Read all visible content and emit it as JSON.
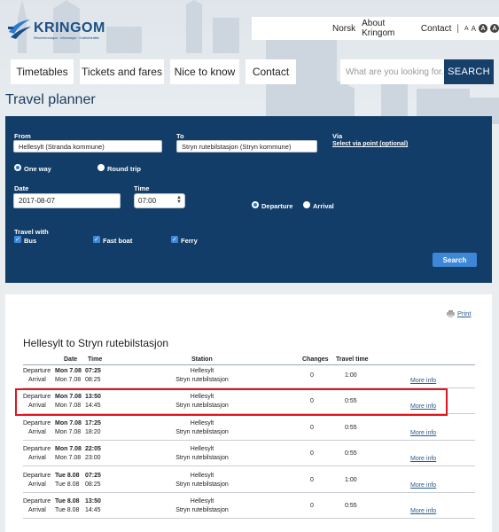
{
  "brand": {
    "name": "KRINGOM",
    "tagline": "Reiseinformasjon · Informasjon · Kollektivtrafikk"
  },
  "topbar": {
    "lang": "Norsk",
    "about": "About Kringom",
    "contact": "Contact",
    "sep": "|",
    "font_sizes": [
      "A",
      "A",
      "A",
      "A"
    ]
  },
  "nav": {
    "items": [
      "Timetables",
      "Tickets and fares",
      "Nice to know",
      "Contact"
    ]
  },
  "search": {
    "placeholder": "What are you looking for..?",
    "button": "SEARCH"
  },
  "planner": {
    "title": "Travel planner",
    "from_label": "From",
    "from_value": "Hellesylt (Stranda kommune)",
    "to_label": "To",
    "to_value": "Stryn rutebilstasjon (Stryn kommune)",
    "via_label": "Via",
    "via_link": "Select via point (optional)",
    "one_way": "One way",
    "round_trip": "Round trip",
    "date_label": "Date",
    "date_value": "2017-08-07",
    "time_label": "Time",
    "time_value": "07:00",
    "departure": "Departure",
    "arrival": "Arrival",
    "travel_with": "Travel with",
    "modes": [
      "Bus",
      "Fast boat",
      "Ferry"
    ],
    "search_button": "Search"
  },
  "results": {
    "print": "Print",
    "title": "Hellesylt to Stryn rutebilstasjon",
    "headers": {
      "date": "Date",
      "time": "Time",
      "station": "Station",
      "changes": "Changes",
      "travel_time": "Travel time"
    },
    "dep_label": "Departure",
    "arr_label": "Arrival",
    "more_info": "More info",
    "rows": [
      {
        "dep_date": "Mon 7.08",
        "dep_time": "07:25",
        "arr_date": "Mon 7.08",
        "arr_time": "08:25",
        "from": "Hellesylt",
        "to": "Stryn rutebilstasjon",
        "changes": "0",
        "travel": "1:00"
      },
      {
        "dep_date": "Mon 7.08",
        "dep_time": "13:50",
        "arr_date": "Mon 7.08",
        "arr_time": "14:45",
        "from": "Hellesylt",
        "to": "Stryn rutebilstasjon",
        "changes": "0",
        "travel": "0:55"
      },
      {
        "dep_date": "Mon 7.08",
        "dep_time": "17:25",
        "arr_date": "Mon 7.08",
        "arr_time": "18:20",
        "from": "Hellesylt",
        "to": "Stryn rutebilstasjon",
        "changes": "0",
        "travel": "0:55"
      },
      {
        "dep_date": "Mon 7.08",
        "dep_time": "22:05",
        "arr_date": "Mon 7.08",
        "arr_time": "23:00",
        "from": "Hellesylt",
        "to": "Stryn rutebilstasjon",
        "changes": "0",
        "travel": "0:55"
      },
      {
        "dep_date": "Tue 8.08",
        "dep_time": "07:25",
        "arr_date": "Tue 8.08",
        "arr_time": "08:25",
        "from": "Hellesylt",
        "to": "Stryn rutebilstasjon",
        "changes": "0",
        "travel": "1:00"
      },
      {
        "dep_date": "Tue 8.08",
        "dep_time": "13:50",
        "arr_date": "Tue 8.08",
        "arr_time": "14:45",
        "from": "Hellesylt",
        "to": "Stryn rutebilstasjon",
        "changes": "0",
        "travel": "0:55"
      }
    ]
  },
  "colors": {
    "planner_bg": "#123d68",
    "accent": "#3d87d6",
    "highlight": "#e0141e",
    "link": "#2a5a8c"
  }
}
